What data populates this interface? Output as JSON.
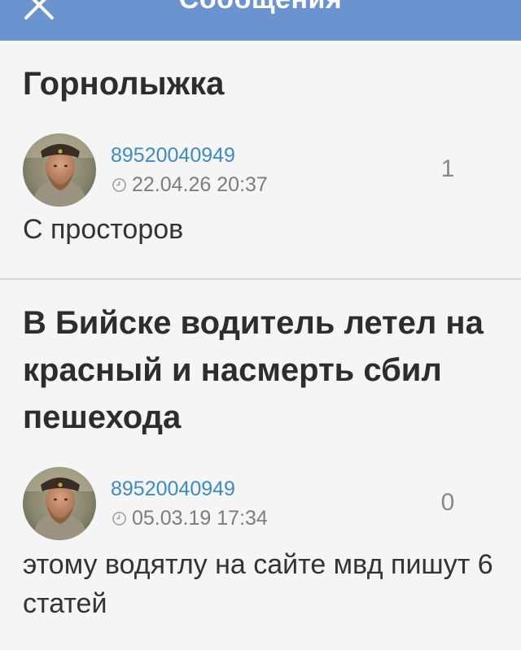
{
  "header": {
    "title": "Сообщения",
    "close_icon": "close-icon",
    "background": "#6a93cf"
  },
  "posts": [
    {
      "title": "Горнолыжка",
      "author": "89520040949",
      "date": "22.04.26 20:37",
      "count": "1",
      "text": "С просторов"
    },
    {
      "title": "В Бийске водитель летел на красный и насмерть сбил пешехода",
      "author": "89520040949",
      "date": "05.03.19 17:34",
      "count": "0",
      "text": "этому водятлу на сайте мвд пишут 6 статей"
    }
  ],
  "colors": {
    "author_link": "#3b8bc4",
    "meta_text": "#7d7d7d",
    "title_text": "#2d2d2d",
    "divider": "#d8d8d8"
  }
}
